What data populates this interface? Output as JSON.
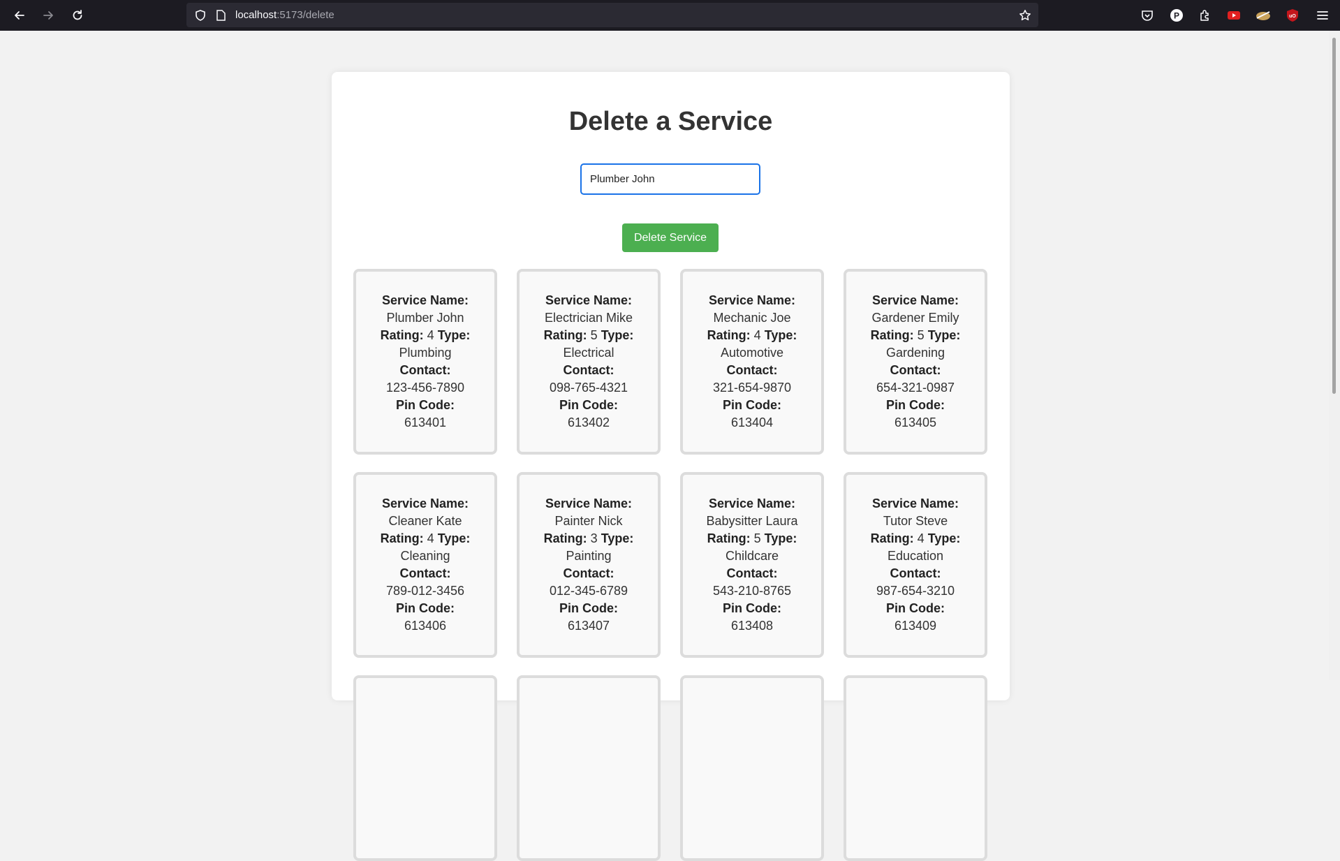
{
  "browser": {
    "url_host": "localhost",
    "url_path": ":5173/delete"
  },
  "page": {
    "title": "Delete a Service",
    "input_value": "Plumber John",
    "button_label": "Delete Service"
  },
  "labels": {
    "name": "Service Name:",
    "rating": "Rating:",
    "type": "Type:",
    "contact": "Contact:",
    "pin": "Pin Code:"
  },
  "services": [
    {
      "name": "Plumber John",
      "rating": "4",
      "type": "Plumbing",
      "contact": "123-456-7890",
      "pin": "613401"
    },
    {
      "name": "Electrician Mike",
      "rating": "5",
      "type": "Electrical",
      "contact": "098-765-4321",
      "pin": "613402"
    },
    {
      "name": "Mechanic Joe",
      "rating": "4",
      "type": "Automotive",
      "contact": "321-654-9870",
      "pin": "613404"
    },
    {
      "name": "Gardener Emily",
      "rating": "5",
      "type": "Gardening",
      "contact": "654-321-0987",
      "pin": "613405"
    },
    {
      "name": "Cleaner Kate",
      "rating": "4",
      "type": "Cleaning",
      "contact": "789-012-3456",
      "pin": "613406"
    },
    {
      "name": "Painter Nick",
      "rating": "3",
      "type": "Painting",
      "contact": "012-345-6789",
      "pin": "613407"
    },
    {
      "name": "Babysitter Laura",
      "rating": "5",
      "type": "Childcare",
      "contact": "543-210-8765",
      "pin": "613408"
    },
    {
      "name": "Tutor Steve",
      "rating": "4",
      "type": "Education",
      "contact": "987-654-3210",
      "pin": "613409"
    },
    {
      "name": "",
      "rating": "",
      "type": "",
      "contact": "",
      "pin": ""
    },
    {
      "name": "",
      "rating": "",
      "type": "",
      "contact": "",
      "pin": ""
    },
    {
      "name": "",
      "rating": "",
      "type": "",
      "contact": "",
      "pin": ""
    },
    {
      "name": "",
      "rating": "",
      "type": "",
      "contact": "",
      "pin": ""
    }
  ]
}
